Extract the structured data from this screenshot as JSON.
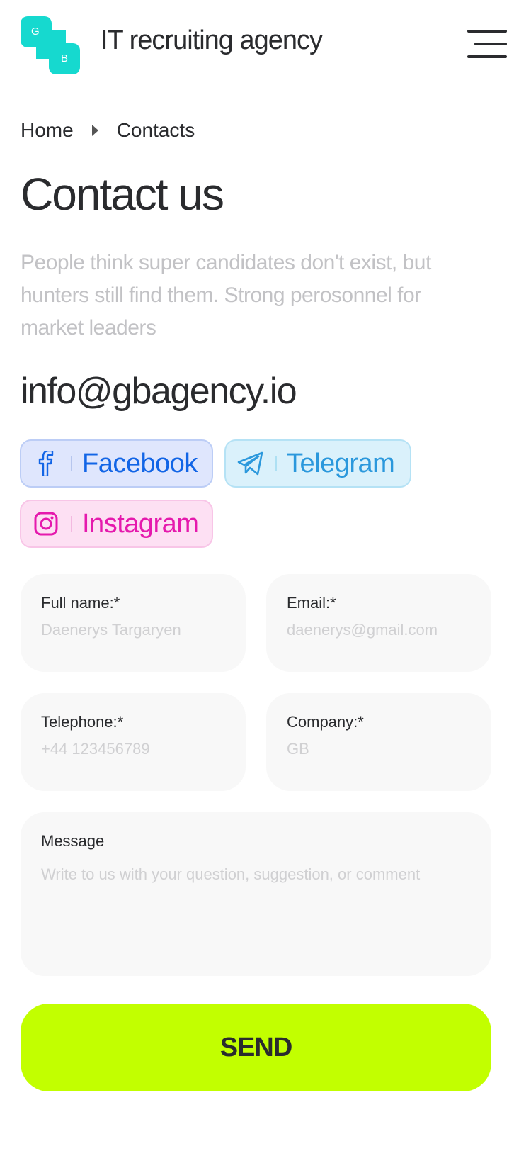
{
  "header": {
    "logo_letters": [
      "G",
      "B"
    ],
    "brand_title": "IT recruiting agency",
    "menu_icon": "hamburger-menu-icon",
    "brand_color": "#16d9cf"
  },
  "breadcrumb": {
    "items": [
      "Home",
      "Contacts"
    ]
  },
  "page": {
    "title": "Contact us",
    "intro": "People think super candidates don't exist, but hunters still find them. Strong perosonnel for market leaders",
    "email": "info@gbagency.io"
  },
  "social": [
    {
      "label": "Facebook",
      "icon": "facebook-icon",
      "color": "#1265e6"
    },
    {
      "label": "Telegram",
      "icon": "telegram-icon",
      "color": "#2b98dc"
    },
    {
      "label": "Instagram",
      "icon": "instagram-icon",
      "color": "#e51aad"
    }
  ],
  "form": {
    "full_name": {
      "label": "Full name:*",
      "placeholder": "Daenerys Targaryen"
    },
    "email": {
      "label": "Email:*",
      "placeholder": "daenerys@gmail.com"
    },
    "telephone": {
      "label": "Telephone:*",
      "placeholder": "+44 123456789"
    },
    "company": {
      "label": "Company:*",
      "placeholder": "GB"
    },
    "message": {
      "label": "Message",
      "placeholder": "Write to us with your question, suggestion, or comment"
    },
    "send_label": "SEND",
    "send_color": "#c2ff00"
  }
}
